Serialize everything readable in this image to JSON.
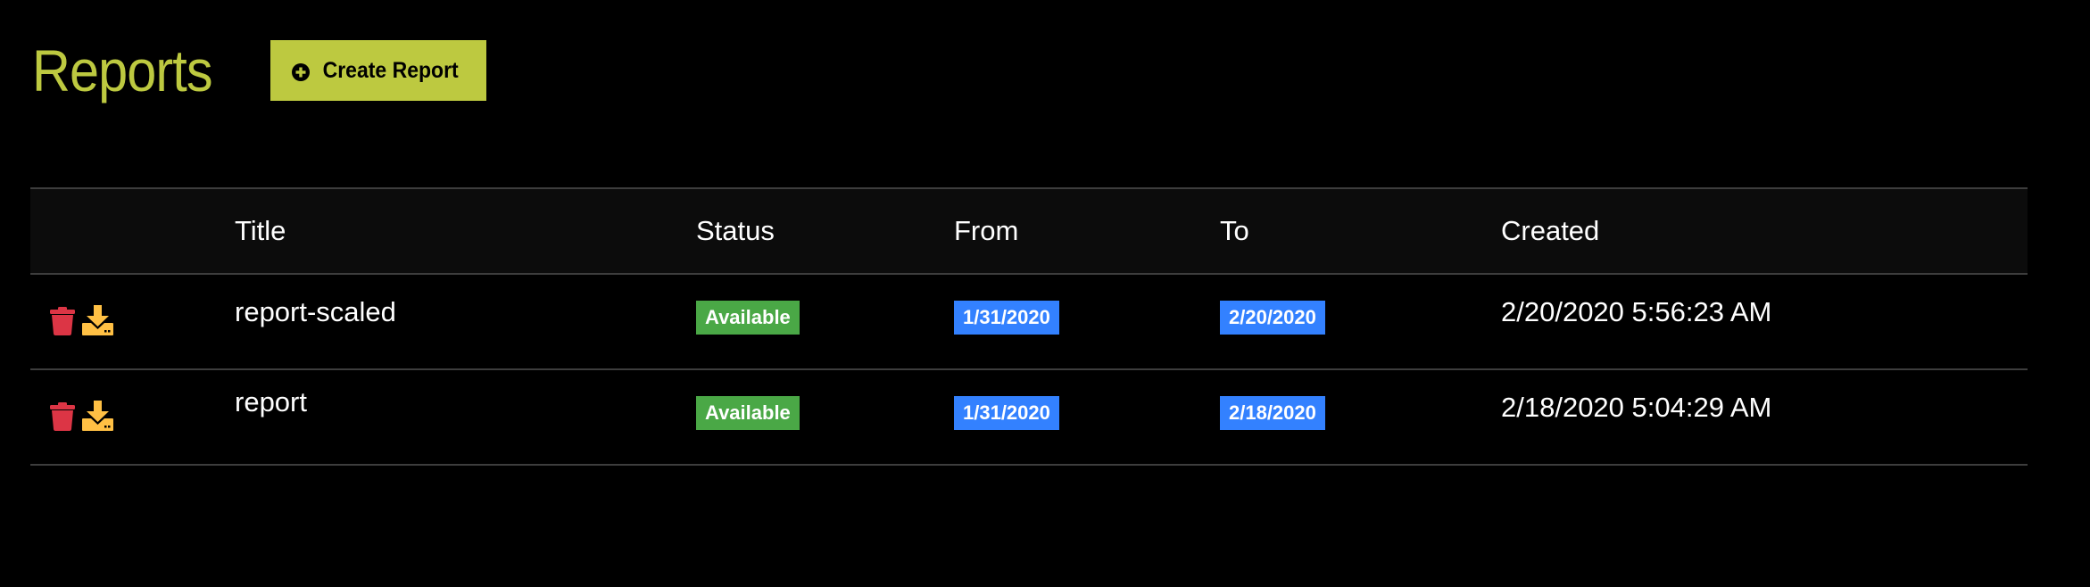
{
  "header": {
    "title": "Reports",
    "create_button_label": "Create Report",
    "create_button_icon": "plus-circle-icon"
  },
  "colors": {
    "accent": "#bdc940",
    "delete": "#dc3545",
    "download": "#ffc044",
    "status_available": "#4aa846",
    "date_badge": "#3381ff",
    "header_bg": "#0c0c0c",
    "page_bg": "#000000"
  },
  "table": {
    "columns": [
      "",
      "Title",
      "Status",
      "From",
      "To",
      "Created"
    ],
    "rows": [
      {
        "actions": [
          "trash-icon",
          "download-icon"
        ],
        "title": "report-scaled",
        "status": "Available",
        "from": "1/31/2020",
        "to": "2/20/2020",
        "created": "2/20/2020 5:56:23 AM"
      },
      {
        "actions": [
          "trash-icon",
          "download-icon"
        ],
        "title": "report",
        "status": "Available",
        "from": "1/31/2020",
        "to": "2/18/2020",
        "created": "2/18/2020 5:04:29 AM"
      }
    ]
  }
}
